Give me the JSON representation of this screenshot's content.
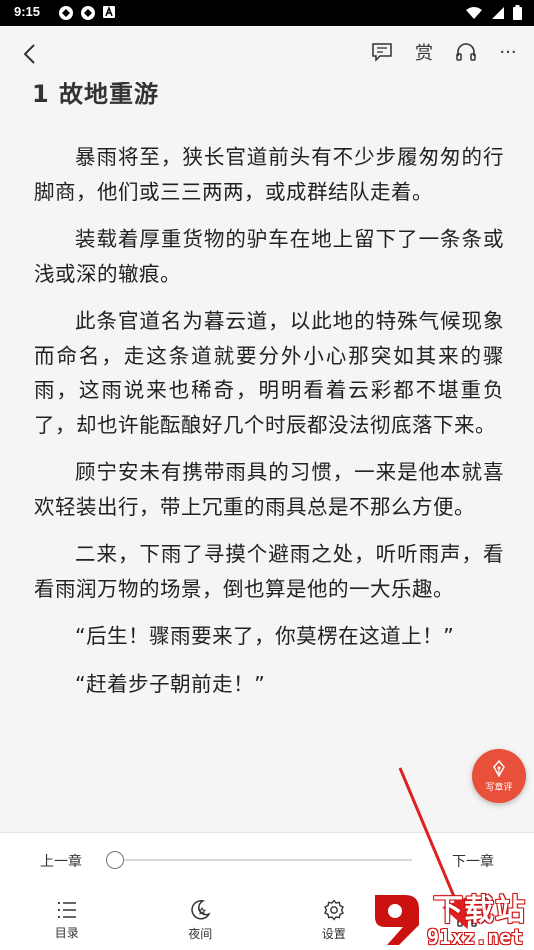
{
  "status_bar": {
    "time": "9:15",
    "left_icons": [
      "notification-icon",
      "notification-icon",
      "a-badge-icon"
    ],
    "right_icons": [
      "wifi-icon",
      "signal-icon",
      "battery-icon"
    ]
  },
  "toolbar": {
    "back_icon": "chevron-left-icon",
    "actions": [
      {
        "name": "comment-icon",
        "glyph": ""
      },
      {
        "name": "reward",
        "glyph": "赏"
      },
      {
        "name": "headphones-icon",
        "glyph": ""
      },
      {
        "name": "more-icon",
        "glyph": "···"
      }
    ]
  },
  "reader": {
    "chapter_title": "1 故地重游",
    "paragraphs": [
      "暴雨将至，狭长官道前头有不少步履匆匆的行脚商，他们或三三两两，或成群结队走着。",
      "装载着厚重货物的驴车在地上留下了一条条或浅或深的辙痕。",
      "此条官道名为暮云道，以此地的特殊气候现象而命名，走这条道就要分外小心那突如其来的骤雨，这雨说来也稀奇，明明看着云彩都不堪重负了，却也许能酝酿好几个时辰都没法彻底落下来。",
      "顾宁安未有携带雨具的习惯，一来是他本就喜欢轻装出行，带上冗重的雨具总是不那么方便。",
      "二来，下雨了寻摸个避雨之处，听听雨声，看看雨润万物的场景，倒也算是他的一大乐趣。",
      "“后生！骤雨要来了，你莫楞在这道上！”",
      "“赶着步子朝前走！”"
    ]
  },
  "review_fab": {
    "label": "写章评",
    "color": "#e8503a"
  },
  "chapter_nav": {
    "prev_label": "上一章",
    "next_label": "下一章",
    "progress": 0.0
  },
  "menu": [
    {
      "name": "menu-item-catalog",
      "icon": "list-icon",
      "label": "目录"
    },
    {
      "name": "menu-item-night",
      "icon": "moon-icon",
      "label": "夜间"
    },
    {
      "name": "menu-item-settings",
      "icon": "gear-icon",
      "label": "设置"
    },
    {
      "name": "menu-item-listen",
      "icon": "headphones-icon",
      "label": ""
    }
  ],
  "watermark": {
    "text": "下载站",
    "domain": "91xz.net",
    "logo_color": "#cc1111"
  },
  "annotation": {
    "color": "#e02020"
  }
}
